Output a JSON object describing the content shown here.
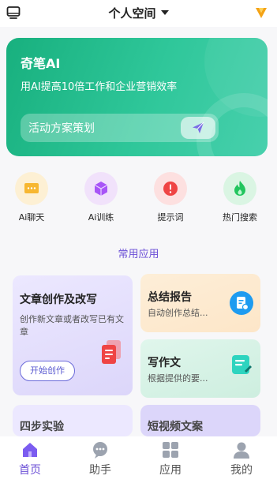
{
  "header": {
    "title": "个人空间",
    "left_icon": "monitor-icon",
    "right_icon": "vip-crown-icon"
  },
  "hero": {
    "title": "奇笔AI",
    "subtitle": "用AI提高10倍工作和企业营销效率",
    "input_value": "活动方案策划",
    "send_icon": "send-icon",
    "color": "#22b888"
  },
  "quick_actions": [
    {
      "label": "Ai聊天",
      "icon": "chat-icon",
      "color": "#f7b731"
    },
    {
      "label": "Ai训练",
      "icon": "cube-icon",
      "color": "#a855f7"
    },
    {
      "label": "提示词",
      "icon": "alert-icon",
      "color": "#ef4444"
    },
    {
      "label": "热门搜索",
      "icon": "flame-icon",
      "color": "#22c55e"
    }
  ],
  "section_title": "常用应用",
  "cards": {
    "big": {
      "title": "文章创作及改写",
      "desc": "创作新文章或者改写已有文章",
      "button": "开始创作"
    },
    "r1": {
      "title": "总结报告",
      "desc": "自动创作总结..."
    },
    "r2": {
      "title": "写作文",
      "desc": "根据提供的要..."
    },
    "peek1": {
      "title": "四步实验"
    },
    "peek2": {
      "title": "短视频文案"
    }
  },
  "tabbar": [
    {
      "label": "首页",
      "icon": "home-icon",
      "active": true
    },
    {
      "label": "助手",
      "icon": "assistant-icon",
      "active": false
    },
    {
      "label": "应用",
      "icon": "apps-grid-icon",
      "active": false
    },
    {
      "label": "我的",
      "icon": "profile-icon",
      "active": false
    }
  ],
  "accent_color": "#6b4fd6"
}
